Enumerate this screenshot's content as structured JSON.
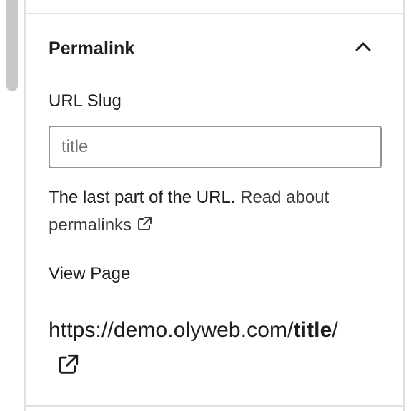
{
  "panel": {
    "section_title": "Permalink",
    "url_slug_label": "URL Slug",
    "url_slug_placeholder": "title",
    "url_slug_value": "",
    "help_text_prefix": "The last part of the URL. ",
    "help_link_text": "Read about permalinks",
    "view_page_label": "View Page",
    "view_url_base": "https://demo.olyweb.com/",
    "view_url_slug": "title",
    "view_url_suffix": "/"
  },
  "icons": {
    "collapse": "chevron-up-icon",
    "help_external": "external-link-icon",
    "view_external": "external-link-icon"
  },
  "colors": {
    "text": "#1e1e1e",
    "border": "#949494",
    "divider": "#e0e0e0",
    "placeholder": "#757575",
    "scrollbar": "#c7c7c7"
  }
}
